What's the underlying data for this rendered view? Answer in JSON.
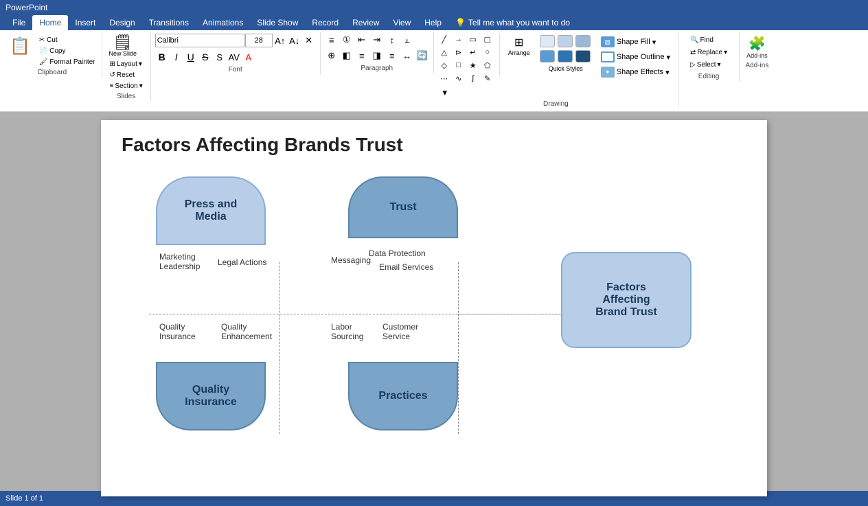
{
  "titlebar": {
    "title": "PowerPoint"
  },
  "tabs": [
    {
      "label": "File",
      "active": false
    },
    {
      "label": "Home",
      "active": true
    },
    {
      "label": "Insert",
      "active": false
    },
    {
      "label": "Design",
      "active": false
    },
    {
      "label": "Transitions",
      "active": false
    },
    {
      "label": "Animations",
      "active": false
    },
    {
      "label": "Slide Show",
      "active": false
    },
    {
      "label": "Record",
      "active": false
    },
    {
      "label": "Review",
      "active": false
    },
    {
      "label": "View",
      "active": false
    },
    {
      "label": "Help",
      "active": false
    }
  ],
  "ribbon": {
    "new_slide_label": "New\nSlide",
    "layout_label": "Layout",
    "reset_label": "Reset",
    "section_label": "Section",
    "slides_group": "Slides",
    "font_group": "Font",
    "paragraph_group": "Paragraph",
    "drawing_group": "Drawing",
    "editing_group": "Editing",
    "addins_group": "Add-ins",
    "font_name": "Calibri",
    "font_size": "28",
    "shape_fill": "Shape Fill",
    "shape_outline": "Shape Outline",
    "shape_effects": "Shape Effects",
    "arrange_label": "Arrange",
    "quick_styles_label": "Quick\nStyles",
    "find_label": "Find",
    "replace_label": "Replace",
    "select_label": "Select",
    "tell_me": "Tell me what you want to do"
  },
  "slide": {
    "title": "Factors Affecting Brands Trust",
    "shapes": {
      "press_media": "Press and\nMedia",
      "trust": "Trust",
      "quality_insurance": "Quality\nInsurance",
      "practices": "Practices",
      "factors": "Factors\nAffecting\nBrand Trust"
    },
    "labels": {
      "marketing_leadership": "Marketing\nLeadership",
      "legal_actions": "Legal Actions",
      "data_protection": "Data Protection",
      "email_services": "Email Services",
      "quality_insurance_text": "Quality\nInsurance",
      "quality_enhancement": "Quality\nEnhancement",
      "messaging": "Messaging",
      "labor_sourcing": "Labor\nSourcing",
      "customer_service": "Customer\nService"
    }
  },
  "statusbar": {
    "slide_info": "Slide 1 of 1"
  }
}
